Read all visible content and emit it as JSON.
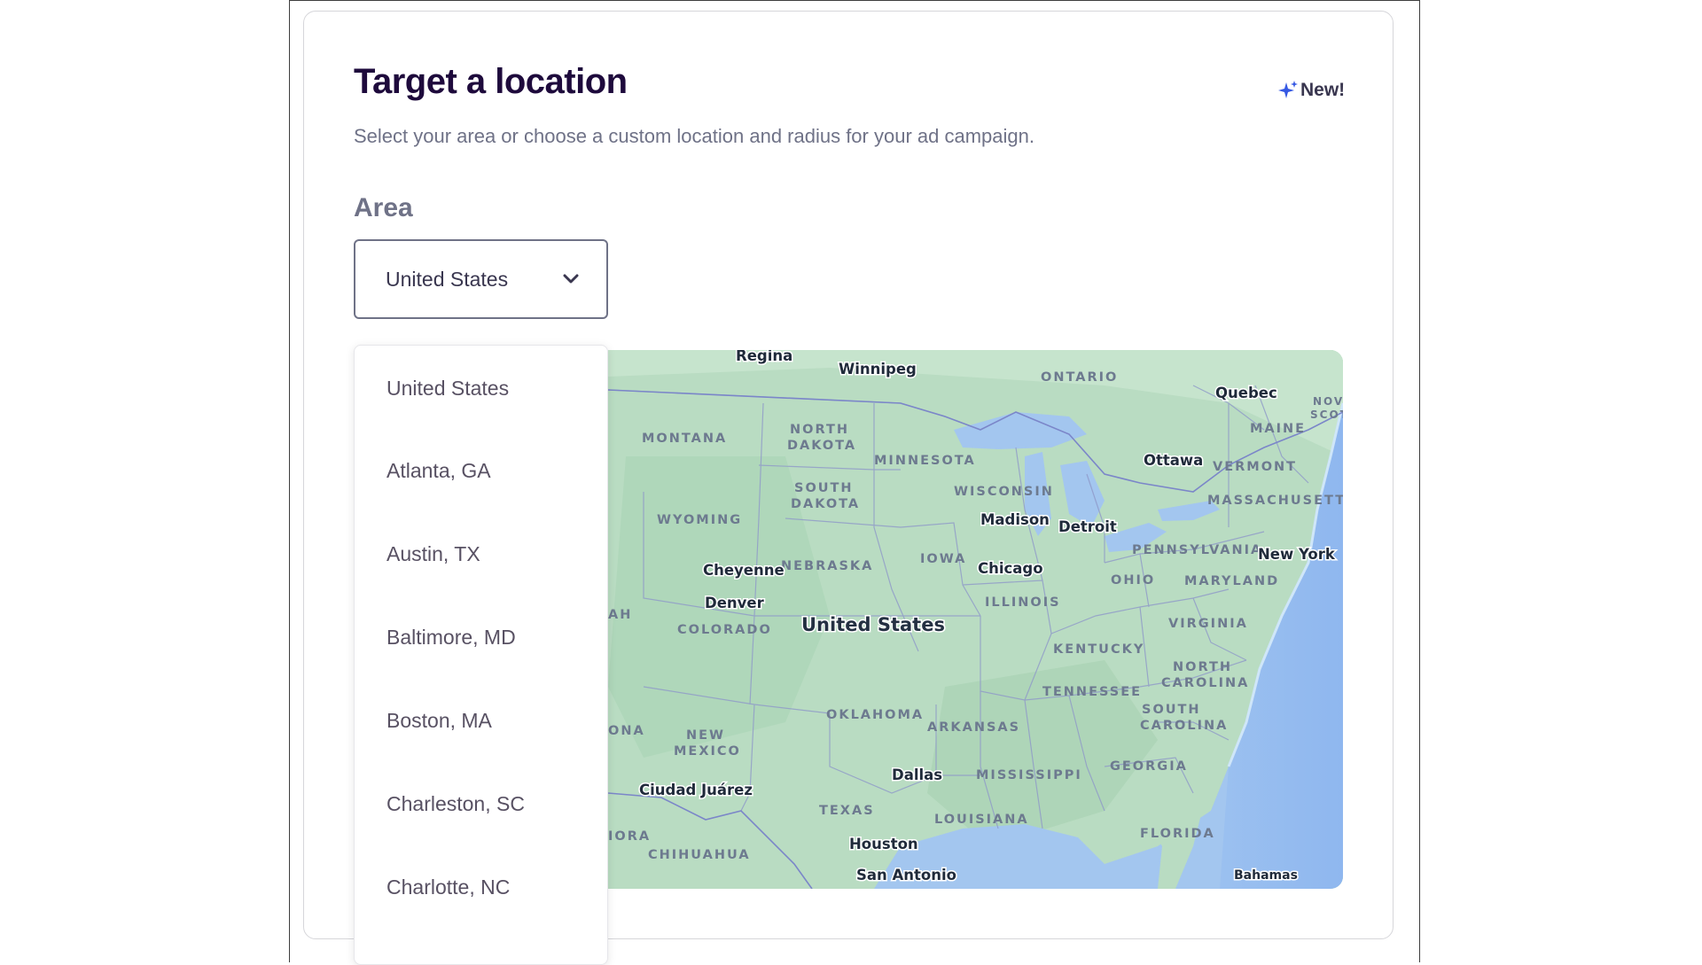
{
  "header": {
    "title": "Target a location",
    "badge": "New!",
    "subtitle": "Select your area or choose a custom location and radius for your ad campaign."
  },
  "area": {
    "label": "Area",
    "selected": "United States",
    "options": [
      "United States",
      "Atlanta, GA",
      "Austin, TX",
      "Baltimore, MD",
      "Boston, MA",
      "Charleston, SC",
      "Charlotte, NC"
    ]
  },
  "map": {
    "region_labels": [
      "ONTARIO",
      "MONTANA",
      "NORTH",
      "DAKOTA",
      "SOUTH",
      "DAKOTA",
      "MINNESOTA",
      "WISCONSIN",
      "WYOMING",
      "NEBRASKA",
      "IOWA",
      "ILLINOIS",
      "OHIO",
      "PENNSYLVANIA",
      "MARYLAND",
      "VIRGINIA",
      "KENTUCKY",
      "NORTH",
      "CAROLINA",
      "TENNESSEE",
      "SOUTH",
      "CAROLINA",
      "COLORADO",
      "OKLAHOMA",
      "ARKANSAS",
      "NEW",
      "MEXICO",
      "MISSISSIPPI",
      "GEORGIA",
      "TEXAS",
      "LOUISIANA",
      "FLORIDA",
      "CHIHUAHUA",
      "MAINE",
      "VERMONT",
      "MASSACHUSETTS",
      "NOVA",
      "SCOT",
      "AH",
      "ONA",
      "IORA"
    ],
    "city_labels": [
      "Regina",
      "Winnipeg",
      "Quebec",
      "Ottawa",
      "Madison",
      "Detroit",
      "New York",
      "Cheyenne",
      "Chicago",
      "Denver",
      "Dallas",
      "Ciudad Juárez",
      "Houston",
      "San Antonio",
      "Bahamas"
    ],
    "country_label": "United States"
  },
  "colors": {
    "title": "#1e0a3c",
    "text_muted": "#6f7287",
    "badge_icon": "#3659e3",
    "land": "#b7dcc1",
    "water": "#9fc4f2"
  },
  "icons": {
    "badge": "sparkle-icon",
    "select": "chevron-down-icon"
  }
}
